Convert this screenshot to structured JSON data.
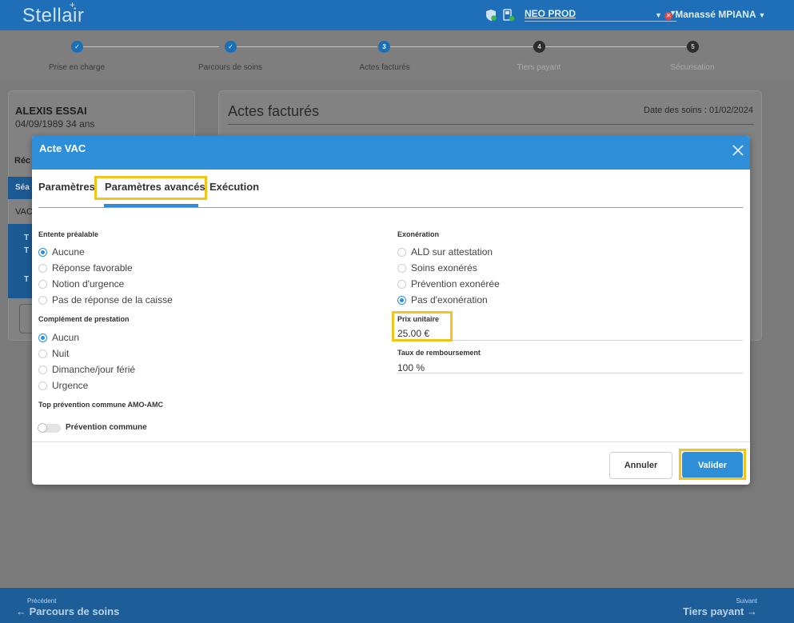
{
  "app": {
    "logo": "Stellair",
    "environment": "NEO PROD",
    "user": "Manassé MPIANA"
  },
  "stepper": [
    {
      "label": "Prise en charge",
      "marker": "✓",
      "state": "done"
    },
    {
      "label": "Parcours de soins",
      "marker": "✓",
      "state": "done"
    },
    {
      "label": "Actes facturés",
      "marker": "3",
      "state": "active"
    },
    {
      "label": "Tiers payant",
      "marker": "4",
      "state": "pending"
    },
    {
      "label": "Sécurisation",
      "marker": "5",
      "state": "pending"
    }
  ],
  "patient": {
    "name": "ALEXIS ESSAI",
    "dob": "04/09/1989 34 ans"
  },
  "background": {
    "left_fragments": [
      "Réc",
      "Séa",
      "VAC",
      "T",
      "T",
      "T"
    ],
    "title": "Actes facturés",
    "date": "Date des soins : 01/02/2024"
  },
  "modal": {
    "title": "Acte VAC",
    "tabs": [
      {
        "label": "Paramètres"
      },
      {
        "label": "Paramètres avancés",
        "active": true
      },
      {
        "label": "Exécution"
      }
    ],
    "entente": {
      "label": "Entente préalable",
      "options": [
        {
          "label": "Aucune",
          "selected": true
        },
        {
          "label": "Réponse favorable",
          "selected": false
        },
        {
          "label": "Notion d'urgence",
          "selected": false
        },
        {
          "label": "Pas de réponse de la caisse",
          "selected": false
        }
      ]
    },
    "complement": {
      "label": "Complément de prestation",
      "options": [
        {
          "label": "Aucun",
          "selected": true
        },
        {
          "label": "Nuit",
          "selected": false
        },
        {
          "label": "Dimanche/jour férié",
          "selected": false
        },
        {
          "label": "Urgence",
          "selected": false
        }
      ]
    },
    "top_prevention": {
      "label": "Top prévention commune AMO-AMC",
      "toggle_label": "Prévention commune",
      "on": false
    },
    "exoneration": {
      "label": "Exonération",
      "options": [
        {
          "label": "ALD sur attestation",
          "selected": false
        },
        {
          "label": "Soins exonérés",
          "selected": false
        },
        {
          "label": "Prévention exonérée",
          "selected": false
        },
        {
          "label": "Pas d'exonération",
          "selected": true
        }
      ]
    },
    "prix_unitaire": {
      "label": "Prix unitaire",
      "value": "25.00 €"
    },
    "taux": {
      "label": "Taux de remboursement",
      "value": "100 %"
    },
    "buttons": {
      "cancel": "Annuler",
      "ok": "Valider"
    }
  },
  "footer": {
    "prev_small": "Précédent",
    "prev_big": "Parcours de soins",
    "next_small": "Suivant",
    "next_big": "Tiers payant"
  },
  "colors": {
    "primary": "#2e8fd8",
    "header": "#1f6fb8",
    "highlight": "#f0c41a"
  }
}
